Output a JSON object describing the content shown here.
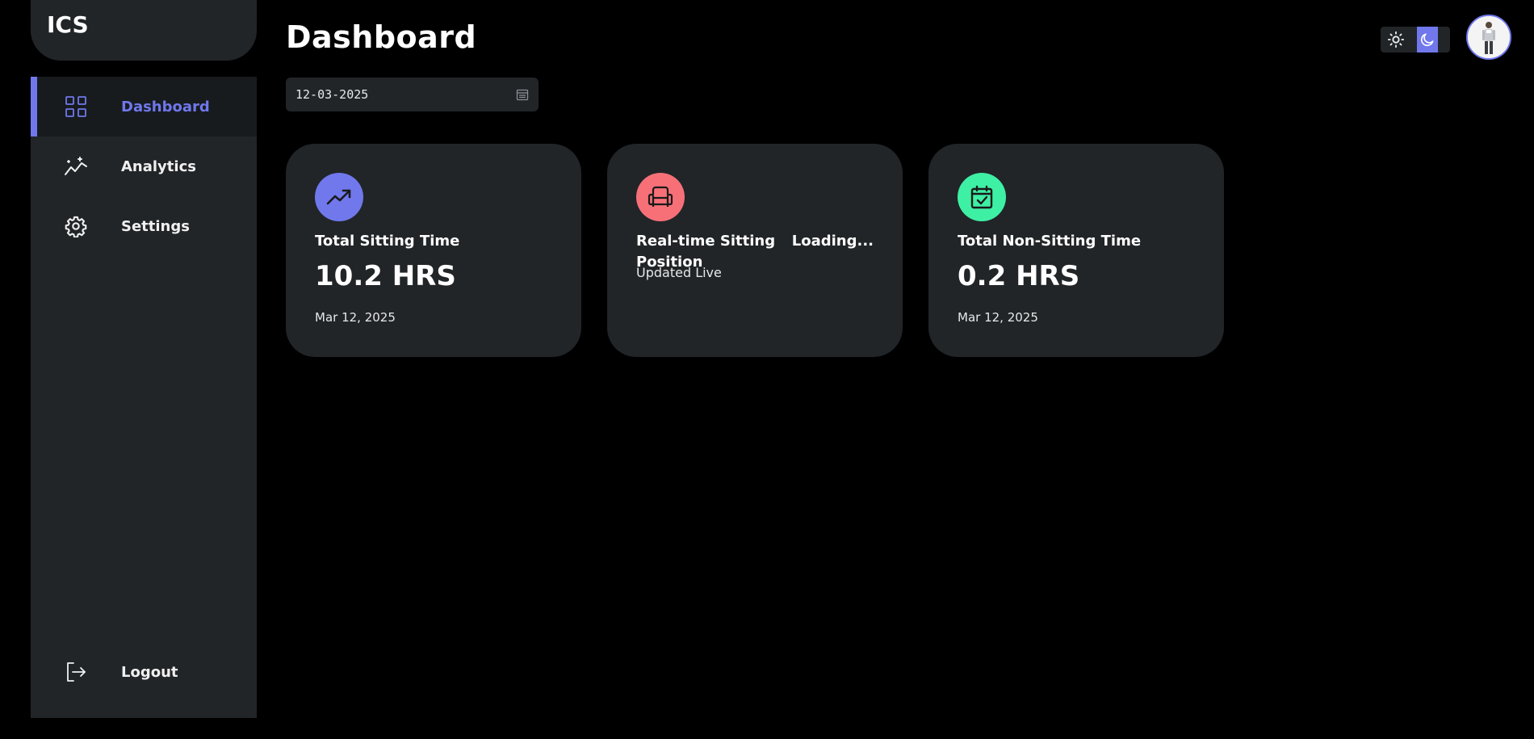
{
  "app": {
    "logo": "ICS"
  },
  "sidebar": {
    "items": [
      {
        "label": "Dashboard",
        "icon": "grid-icon",
        "active": true
      },
      {
        "label": "Analytics",
        "icon": "analytics-icon",
        "active": false
      },
      {
        "label": "Settings",
        "icon": "gear-icon",
        "active": false
      }
    ],
    "logout": {
      "label": "Logout",
      "icon": "logout-icon"
    }
  },
  "header": {
    "title": "Dashboard",
    "date_value": "12-03-2025"
  },
  "theme": {
    "mode": "dark",
    "accent": "#7078ec"
  },
  "cards": [
    {
      "title": "Total Sitting Time",
      "value": "10.2 HRS",
      "date": "Mar 12, 2025",
      "icon": "trend-up-icon",
      "icon_color": "#7078ec"
    },
    {
      "title_line1": "Real-time Sitting",
      "title_line2": "Position",
      "subtitle": "Updated Live",
      "status": "Loading...",
      "icon": "chair-icon",
      "icon_color": "#f77078"
    },
    {
      "title": "Total Non-Sitting Time",
      "value": "0.2 HRS",
      "date": "Mar 12, 2025",
      "icon": "calendar-check-icon",
      "icon_color": "#3ef0a4"
    }
  ]
}
